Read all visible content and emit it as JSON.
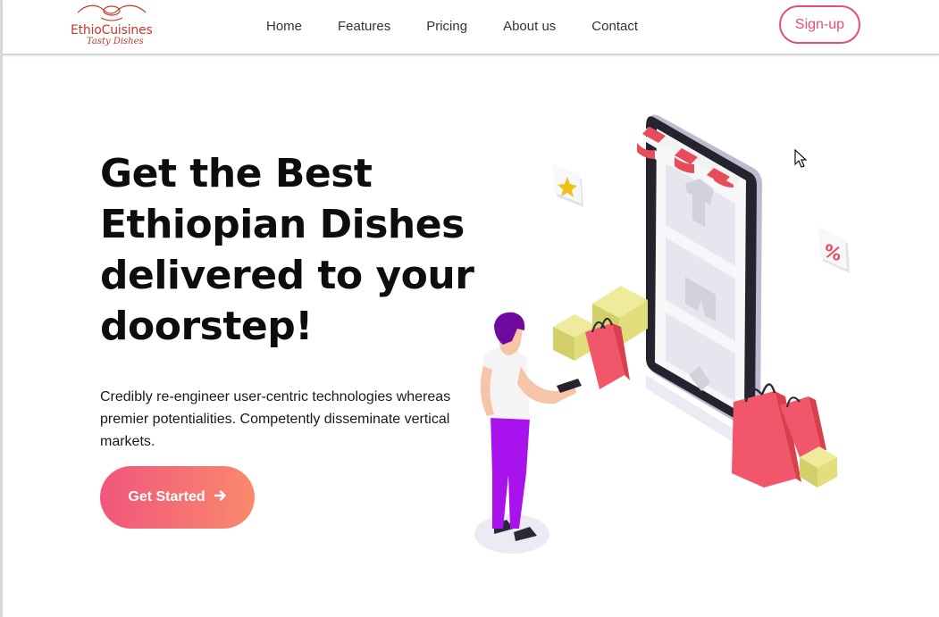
{
  "brand": {
    "name": "EthioCuisines",
    "tagline": "Tasty Dishes"
  },
  "nav": {
    "links": [
      "Home",
      "Features",
      "Pricing",
      "About us",
      "Contact"
    ],
    "signup_label": "Sign-up"
  },
  "hero": {
    "title": "Get the Best Ethiopian Dishes delivered to your doorstep!",
    "description": "Credibly re-engineer user-centric technologies whereas premier potentialities. Competently disseminate vertical markets.",
    "cta_label": "Get Started",
    "cta_icon": "arrow-right-icon"
  },
  "colors": {
    "accent": "#e24f7a",
    "cta_start": "#f0567c",
    "cta_end": "#f98a6c",
    "text": "#0d0d0d"
  }
}
